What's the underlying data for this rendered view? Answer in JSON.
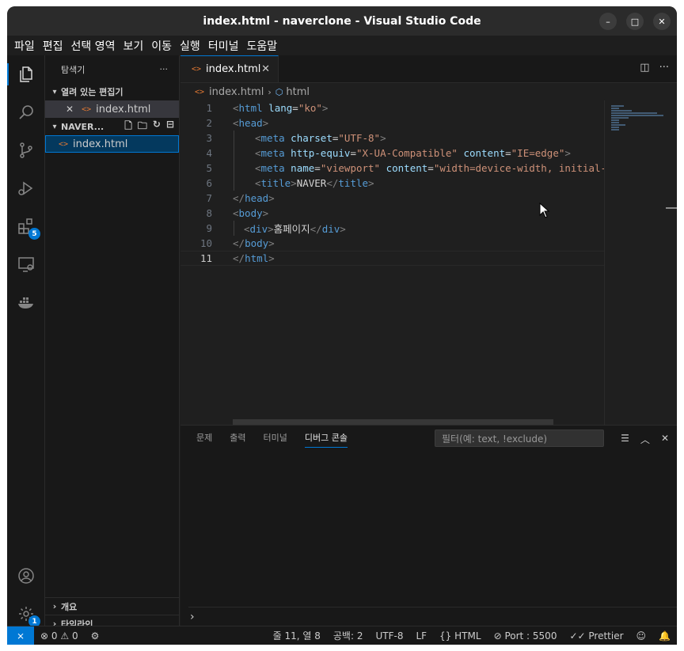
{
  "window": {
    "title": "index.html - naverclone - Visual Studio Code",
    "controls": {
      "minimize": "–",
      "maximize": "□",
      "close": "✕"
    }
  },
  "menubar": [
    "파일",
    "편집",
    "선택 영역",
    "보기",
    "이동",
    "실행",
    "터미널",
    "도움말"
  ],
  "activitybar": {
    "items": [
      {
        "name": "explorer-icon",
        "active": true
      },
      {
        "name": "search-icon"
      },
      {
        "name": "source-control-icon"
      },
      {
        "name": "run-debug-icon"
      },
      {
        "name": "extensions-icon",
        "badge": "5"
      },
      {
        "name": "remote-explorer-icon"
      },
      {
        "name": "docker-icon"
      }
    ],
    "bottom": [
      {
        "name": "accounts-icon"
      },
      {
        "name": "manage-gear-icon",
        "badge": "1"
      }
    ]
  },
  "sidebar": {
    "header": "탐색기",
    "more": "···",
    "open_editors": {
      "title": "열려 있는 편집기",
      "items": [
        {
          "close": "✕",
          "label": "index.html"
        }
      ]
    },
    "folder": {
      "title": "NAVER...",
      "files": [
        {
          "label": "index.html"
        }
      ]
    },
    "outline": "개요",
    "timeline": "타임라인"
  },
  "editor": {
    "tab": {
      "label": "index.html",
      "close": "✕"
    },
    "breadcrumb": {
      "file": "index.html",
      "symbol": "html"
    },
    "current_line": 11,
    "lines": [
      {
        "n": "1",
        "tokens": [
          [
            "br",
            "<"
          ],
          [
            "tag",
            "html"
          ],
          [
            "t",
            " "
          ],
          [
            "attr",
            "lang"
          ],
          [
            "t",
            "="
          ],
          [
            "str",
            "\"ko\""
          ],
          [
            "br",
            ">"
          ]
        ],
        "indent": 0
      },
      {
        "n": "2",
        "tokens": [
          [
            "br",
            "<"
          ],
          [
            "tag",
            "head"
          ],
          [
            "br",
            ">"
          ]
        ],
        "indent": 0
      },
      {
        "n": "3",
        "tokens": [
          [
            "br",
            "<"
          ],
          [
            "tag",
            "meta"
          ],
          [
            "t",
            " "
          ],
          [
            "attr",
            "charset"
          ],
          [
            "t",
            "="
          ],
          [
            "str",
            "\"UTF-8\""
          ],
          [
            "br",
            ">"
          ]
        ],
        "indent": 1
      },
      {
        "n": "4",
        "tokens": [
          [
            "br",
            "<"
          ],
          [
            "tag",
            "meta"
          ],
          [
            "t",
            " "
          ],
          [
            "attr",
            "http-equiv"
          ],
          [
            "t",
            "="
          ],
          [
            "str",
            "\"X-UA-Compatible\""
          ],
          [
            "t",
            " "
          ],
          [
            "attr",
            "content"
          ],
          [
            "t",
            "="
          ],
          [
            "str",
            "\"IE=edge\""
          ],
          [
            "br",
            ">"
          ]
        ],
        "indent": 1
      },
      {
        "n": "5",
        "tokens": [
          [
            "br",
            "<"
          ],
          [
            "tag",
            "meta"
          ],
          [
            "t",
            " "
          ],
          [
            "attr",
            "name"
          ],
          [
            "t",
            "="
          ],
          [
            "str",
            "\"viewport\""
          ],
          [
            "t",
            " "
          ],
          [
            "attr",
            "content"
          ],
          [
            "t",
            "="
          ],
          [
            "str",
            "\"width=device-width, initial-scal"
          ]
        ],
        "indent": 1
      },
      {
        "n": "6",
        "tokens": [
          [
            "br",
            "<"
          ],
          [
            "tag",
            "title"
          ],
          [
            "br",
            ">"
          ],
          [
            "t",
            "NAVER"
          ],
          [
            "br",
            "</"
          ],
          [
            "tag",
            "title"
          ],
          [
            "br",
            ">"
          ]
        ],
        "indent": 1
      },
      {
        "n": "7",
        "tokens": [
          [
            "br",
            "</"
          ],
          [
            "tag",
            "head"
          ],
          [
            "br",
            ">"
          ]
        ],
        "indent": 0
      },
      {
        "n": "8",
        "tokens": [
          [
            "br",
            "<"
          ],
          [
            "tag",
            "body"
          ],
          [
            "br",
            ">"
          ]
        ],
        "indent": 0
      },
      {
        "n": "9",
        "tokens": [
          [
            "br",
            "<"
          ],
          [
            "tag",
            "div"
          ],
          [
            "br",
            ">"
          ],
          [
            "t",
            "홈페이지"
          ],
          [
            "br",
            "</"
          ],
          [
            "tag",
            "div"
          ],
          [
            "br",
            ">"
          ]
        ],
        "indent": 0.5
      },
      {
        "n": "10",
        "tokens": [
          [
            "br",
            "</"
          ],
          [
            "tag",
            "body"
          ],
          [
            "br",
            ">"
          ]
        ],
        "indent": 0
      },
      {
        "n": "11",
        "tokens": [
          [
            "br",
            "</"
          ],
          [
            "tag",
            "html"
          ],
          [
            "br",
            ">"
          ]
        ],
        "indent": 0
      }
    ]
  },
  "panel": {
    "tabs": [
      "문제",
      "출력",
      "터미널",
      "디버그 콘솔"
    ],
    "active_tab": "디버그 콘솔",
    "filter_placeholder": "필터(예: text, !exclude)",
    "prompt": "›"
  },
  "statusbar": {
    "remote": "⨯",
    "errors": "0",
    "warnings": "0",
    "position": "줄 11, 열 8",
    "spaces": "공백: 2",
    "encoding": "UTF-8",
    "eol": "LF",
    "language": "HTML",
    "port": "Port : 5500",
    "prettier": "Prettier"
  }
}
